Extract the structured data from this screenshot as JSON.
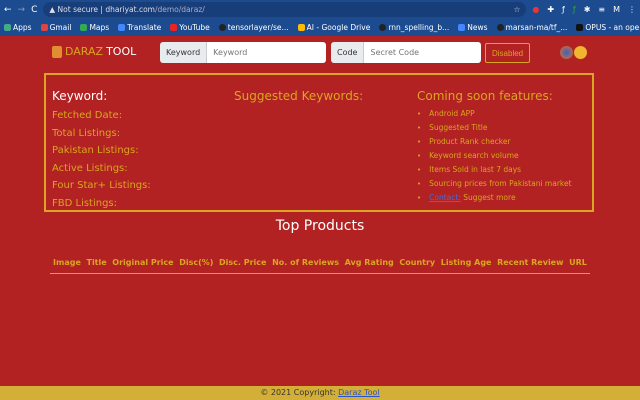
{
  "browser": {
    "security": "Not secure",
    "url_host": "dhariyat.com",
    "url_path": "/demo/daraz/",
    "bookmarks": [
      "Apps",
      "Gmail",
      "Maps",
      "Translate",
      "YouTube",
      "tensorlayer/se...",
      "AI - Google Drive",
      "rnn_spelling_b...",
      "News",
      "marsan-ma/tf_...",
      "OPUS - an ope..."
    ],
    "more": "»",
    "profile": "M"
  },
  "nav": {
    "logo_a": "DARAZ",
    "logo_b": "TOOL",
    "keyword_label": "Keyword",
    "keyword_placeholder": "Keyword",
    "code_label": "Code",
    "code_placeholder": "Secret Code",
    "disabled_button": "Disabled"
  },
  "stats": {
    "keyword": "Keyword:",
    "rows": [
      "Fetched Date:",
      "Total Listings:",
      "Pakistan Listings:",
      "Active Listings:",
      "Four Star+ Listings:",
      "FBD Listings:"
    ]
  },
  "suggested": {
    "title": "Suggested Keywords:"
  },
  "coming": {
    "title": "Coming soon features:",
    "items": [
      "Android APP",
      "Suggested Title",
      "Product Rank checker",
      "Keyword search volume",
      "Items Sold in last 7 days",
      "Sourcing prices from Pakistani market"
    ],
    "contact_link": "Contact:",
    "contact_text": " Suggest more"
  },
  "products": {
    "title": "Top Products",
    "columns": [
      "Image",
      "Title",
      "Original Price",
      "Disc(%)",
      "Disc. Price",
      "No. of Reviews",
      "Avg Rating",
      "Country",
      "Listing Age",
      "Recent Review",
      "URL"
    ]
  },
  "footer": {
    "text": "© 2021 Copyright: ",
    "link": "Daraz Tool"
  }
}
